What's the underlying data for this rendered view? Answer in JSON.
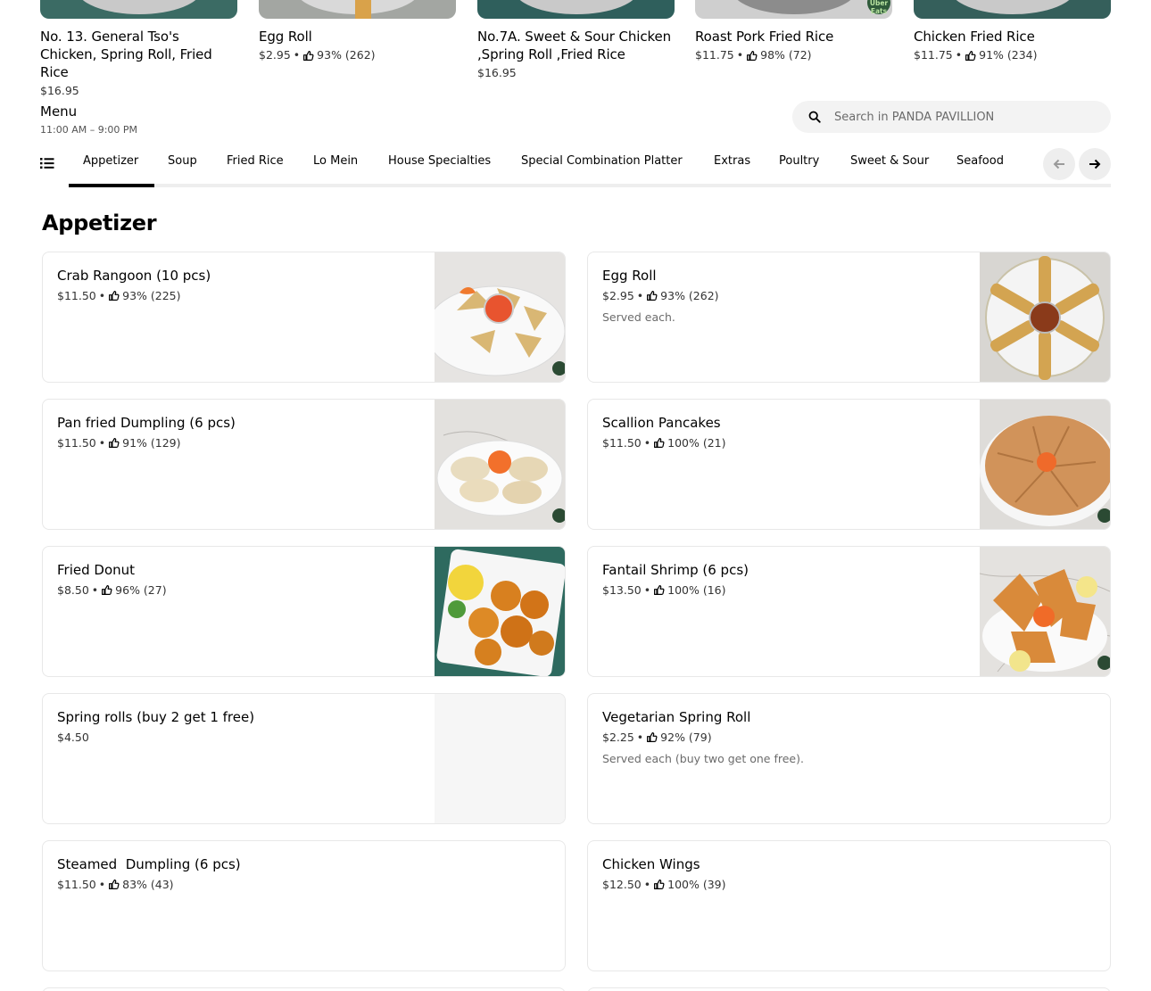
{
  "carousel": [
    {
      "name": "No. 13. General Tso's Chicken, Spring Roll, Fried Rice",
      "price": "$16.95",
      "rating": "",
      "bg": "#3b6b64"
    },
    {
      "name": "Egg Roll",
      "price": "$2.95",
      "rating": "93% (262)",
      "bg": "#a0a39f"
    },
    {
      "name": "No.7A. Sweet & Sour Chicken ,Spring Roll ,Fried Rice",
      "price": "$16.95",
      "rating": "",
      "bg": "#2f5f5c"
    },
    {
      "name": "Roast Pork Fried Rice",
      "price": "$11.75",
      "rating": "98% (72)",
      "bg": "#cfcfcf",
      "badge": "Uber Eats"
    },
    {
      "name": "Chicken Fried Rice",
      "price": "$11.75",
      "rating": "91% (234)",
      "bg": "#355f5b"
    }
  ],
  "menu": {
    "title": "Menu",
    "hours": "11:00 AM – 9:00 PM"
  },
  "search": {
    "placeholder": "Search in PANDA PAVILLION"
  },
  "tabs": [
    "Appetizer",
    "Soup",
    "Fried Rice",
    "Lo Mein",
    "House Specialties",
    "Special Combination Platter",
    "Extras",
    "Poultry",
    "Sweet & Sour",
    "Seafood"
  ],
  "active_tab": "Appetizer",
  "section": {
    "title": "Appetizer"
  },
  "items": [
    {
      "name": "Crab Rangoon (10 pcs)",
      "price": "$11.50",
      "rating": "93% (225)",
      "desc": "",
      "image": "crab-rangoon-photo"
    },
    {
      "name": "Egg Roll",
      "price": "$2.95",
      "rating": "93% (262)",
      "desc": "Served each.",
      "image": "egg-roll-photo"
    },
    {
      "name": "Pan fried Dumpling (6 pcs)",
      "price": "$11.50",
      "rating": "91% (129)",
      "desc": "",
      "image": "dumpling-photo"
    },
    {
      "name": "Scallion Pancakes",
      "price": "$11.50",
      "rating": "100% (21)",
      "desc": "",
      "image": "scallion-pancake-photo"
    },
    {
      "name": "Fried Donut",
      "price": "$8.50",
      "rating": "96% (27)",
      "desc": "",
      "image": "fried-donut-photo"
    },
    {
      "name": "Fantail Shrimp (6 pcs)",
      "price": "$13.50",
      "rating": "100% (16)",
      "desc": "",
      "image": "fantail-shrimp-photo"
    },
    {
      "name": "Spring rolls (buy 2 get 1 free)",
      "price": "$4.50",
      "rating": "",
      "desc": "",
      "image": "placeholder"
    },
    {
      "name": "Vegetarian Spring Roll",
      "price": "$2.25",
      "rating": "92% (79)",
      "desc": "Served each (buy two get one free).",
      "image": ""
    },
    {
      "name": "Steamed  Dumpling (6 pcs)",
      "price": "$11.50",
      "rating": "83% (43)",
      "desc": "",
      "image": ""
    },
    {
      "name": "Chicken Wings",
      "price": "$12.50",
      "rating": "100% (39)",
      "desc": "",
      "image": ""
    }
  ],
  "colors": {
    "text": "#000000",
    "muted": "#6b6b6b",
    "card_border": "#e8e8e8",
    "search_bg": "#f3f3f3",
    "tab_track": "#eeeeee"
  }
}
